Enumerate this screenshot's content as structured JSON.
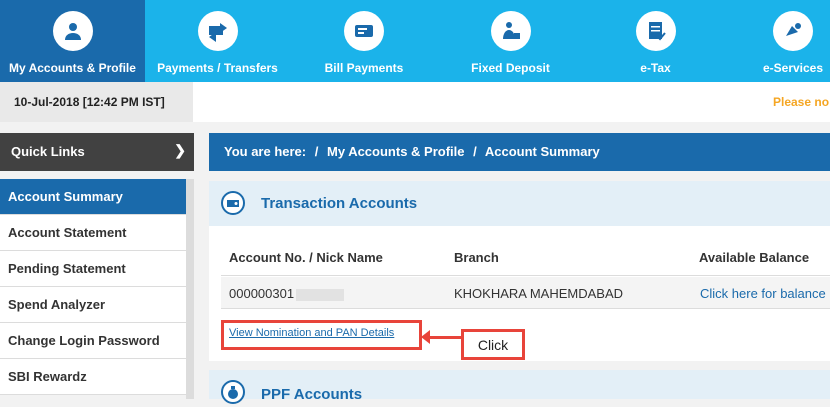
{
  "nav": {
    "items": [
      {
        "label": "My Accounts & Profile",
        "icon": "user-icon"
      },
      {
        "label": "Payments / Transfers",
        "icon": "transfer-icon"
      },
      {
        "label": "Bill Payments",
        "icon": "bill-icon"
      },
      {
        "label": "Fixed Deposit",
        "icon": "deposit-icon"
      },
      {
        "label": "e-Tax",
        "icon": "tax-icon"
      },
      {
        "label": "e-Services",
        "icon": "services-icon"
      }
    ]
  },
  "datetime": "10-Jul-2018 [12:42 PM IST]",
  "notice": "Please no",
  "quick_links": "Quick Links",
  "sidebar": {
    "items": [
      {
        "label": "Account Summary"
      },
      {
        "label": "Account Statement"
      },
      {
        "label": "Pending Statement"
      },
      {
        "label": "Spend Analyzer"
      },
      {
        "label": "Change Login Password"
      },
      {
        "label": "SBI Rewardz"
      }
    ]
  },
  "breadcrumb": {
    "prefix": "You are here:",
    "sep": "/",
    "items": [
      "My Accounts & Profile",
      "Account Summary"
    ]
  },
  "transaction": {
    "title": "Transaction Accounts",
    "columns": [
      "Account No. / Nick Name",
      "Branch",
      "Available Balance"
    ],
    "rows": [
      {
        "account": "000000301",
        "branch": "KHOKHARA MAHEMDABAD",
        "balance": "Click here for balance"
      }
    ],
    "view_link": "View Nomination and PAN Details"
  },
  "annotation": {
    "label": "Click"
  },
  "ppf": {
    "title": "PPF Accounts"
  },
  "colors": {
    "nav_bg": "#1bb3ea",
    "active_blue": "#1a6aab",
    "annotation_red": "#e8443a",
    "notice_orange": "#f5a623"
  }
}
